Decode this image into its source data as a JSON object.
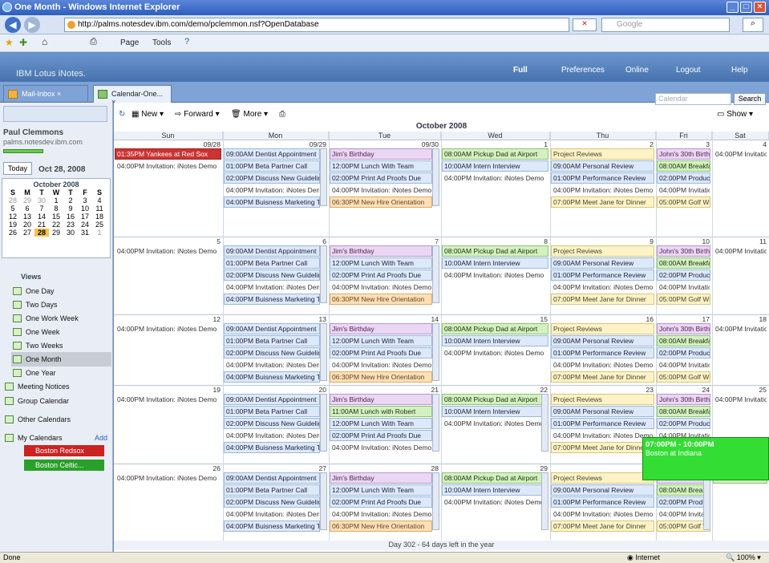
{
  "window": {
    "title": "One Month - Windows Internet Explorer"
  },
  "browser": {
    "url": "http://palms.notesdev.ibm.com/demo/pclemmon.nsf?OpenDatabase",
    "search_placeholder": "Google",
    "cmd_page": "Page",
    "cmd_tools": "Tools"
  },
  "notes": {
    "brand": "IBM Lotus iNotes.",
    "full": "Full",
    "preferences": "Preferences",
    "online": "Online",
    "logout": "Logout",
    "help": "Help"
  },
  "tabs": [
    {
      "label": "Mail-Inbox"
    },
    {
      "label": "Calendar-One..."
    }
  ],
  "left": {
    "user": "Paul Clemmons",
    "server": "palms.notesdev.ibm.com",
    "today_btn": "Today",
    "today_date": "Oct 28, 2008",
    "mini_month": "October 2008",
    "views_label": "Views",
    "views": [
      "One Day",
      "Two Days",
      "One Work Week",
      "One Week",
      "Two Weeks",
      "One Month",
      "One Year"
    ],
    "meeting_notices": "Meeting Notices",
    "group_calendar": "Group Calendar",
    "other_calendars": "Other Calendars",
    "my_calendars": "My Calendars",
    "add": "Add",
    "calendars": [
      "Boston Redsox",
      "Boston Celtic..."
    ]
  },
  "toolbar": {
    "new": "New",
    "forward": "Forward",
    "more": "More",
    "search_placeholder": "Calendar",
    "search_btn": "Search",
    "show": "Show"
  },
  "calendar": {
    "month_title": "October 2008",
    "days": [
      "Sun",
      "Mon",
      "Tue",
      "Wed",
      "Thu",
      "Fri",
      "Sat"
    ],
    "footer": "Day 302 - 64 days left in the year"
  },
  "popup": {
    "time": "07:00PM - 10:00PM",
    "text": "Boston at Indiana"
  },
  "statusbar": {
    "left": "Done",
    "zone": "Internet",
    "zoom": "100%"
  }
}
